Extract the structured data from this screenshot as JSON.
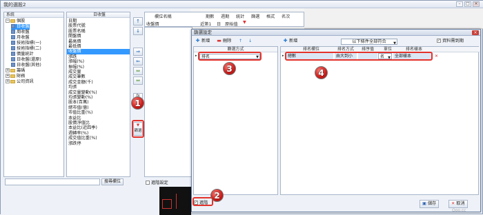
{
  "window": {
    "title": "我的選股2"
  },
  "tree": {
    "header": "系統",
    "items": [
      {
        "label": "個股",
        "kind": "folder"
      },
      {
        "label": "日收盤",
        "kind": "leaf",
        "selected": true
      },
      {
        "label": "周收盤",
        "kind": "leaf"
      },
      {
        "label": "月收盤",
        "kind": "leaf"
      },
      {
        "label": "技術指標(一)",
        "kind": "leaf"
      },
      {
        "label": "技術指標(二)",
        "kind": "leaf"
      },
      {
        "label": "價量統計",
        "kind": "leaf"
      },
      {
        "label": "日收盤(還原)",
        "kind": "leaf"
      },
      {
        "label": "日收盤(其他)",
        "kind": "leaf"
      },
      {
        "label": "籌碼",
        "kind": "folder"
      },
      {
        "label": "財務",
        "kind": "folder"
      },
      {
        "label": "公司資訊",
        "kind": "folder"
      }
    ]
  },
  "fields": {
    "header": "日收盤",
    "items": [
      "日期",
      "股票代號",
      "股票名稱",
      "開盤價",
      "最高價",
      "最低價",
      "收盤價",
      "漲跌",
      "漲幅(%)",
      "振幅(%)",
      "成交量",
      "成交筆數",
      "成交金額(千)",
      "均張",
      "成交量變動(%)",
      "均張變動(%)",
      "股本(百萬)",
      "總市值(億)",
      "市值比重(%)",
      "本益比",
      "股價淨值比",
      "本益比(近四季)",
      "週轉率(%)",
      "成交值比重(%)",
      "漲跌停"
    ],
    "selected_index": 6
  },
  "side_buttons": [
    "↑",
    "↓",
    "⇒",
    "⇐",
    "⇔",
    "⇔",
    "自訂",
    "篩選"
  ],
  "side_button_labels": {
    "custom": "自訂",
    "filter": "篩選"
  },
  "columns": {
    "headers": [
      "欄位名稱",
      "期數",
      "週期",
      "統計",
      "篩選",
      "格式",
      "名次"
    ],
    "row": {
      "name": "收盤價",
      "period": "近第1",
      "cycle": "日",
      "stat": "原始值"
    }
  },
  "outer_bottom": {
    "search_button": "搜尋欄位",
    "advanced": "進階設定"
  },
  "dialog": {
    "title": "篩選設定",
    "toolbar_left": {
      "add": "新增",
      "delete": "刪除"
    },
    "toolbar_right": {
      "add": "新增",
      "condition": "以下條件全部符合",
      "only_data": "資料需到期"
    },
    "left_header": "篩選方式",
    "left_row": {
      "value": "排名"
    },
    "right_headers": [
      "排名欄位",
      "排名方式",
      "排序值",
      "單位",
      "排名樣本"
    ],
    "right_row": {
      "field": "總數",
      "method": "由大到小",
      "sort_value": "",
      "unit": "名",
      "sample": "全部樣本"
    },
    "advanced": "進階",
    "save": "儲存",
    "cancel": "取消"
  },
  "callouts": [
    "1",
    "2",
    "3",
    "4"
  ],
  "watermark": "Ooo.cc"
}
